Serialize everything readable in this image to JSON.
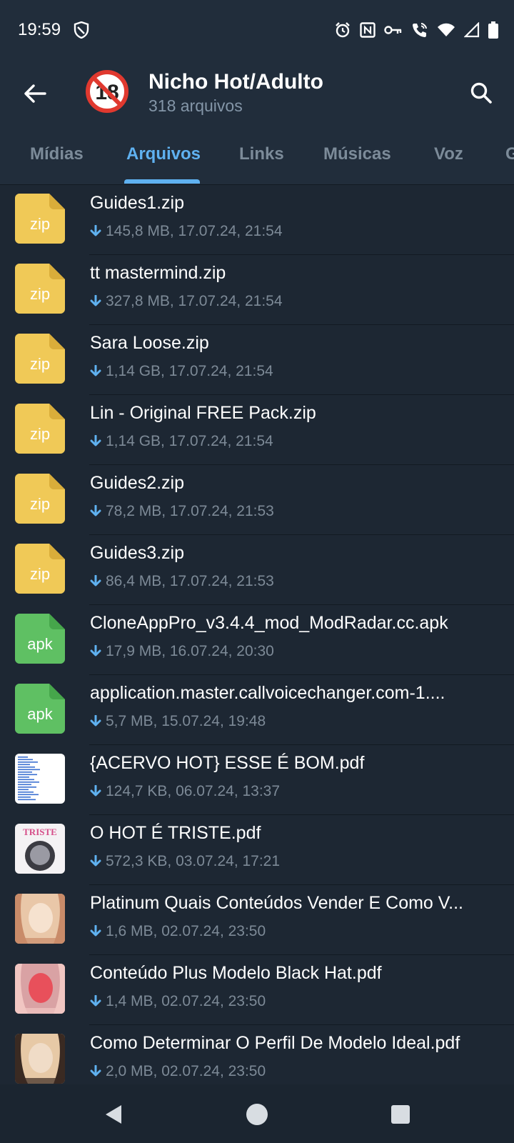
{
  "status_bar": {
    "time": "19:59",
    "icons": [
      "shield-icon",
      "alarm-icon",
      "nfc-icon",
      "key-icon",
      "wifi-call-icon",
      "wifi-icon",
      "signal-icon",
      "battery-icon"
    ]
  },
  "header": {
    "title": "Nicho Hot/Adulto",
    "subtitle": "318 arquivos",
    "avatar_text": "18",
    "back_icon": "arrow-left-icon",
    "search_icon": "search-icon"
  },
  "tabs": [
    {
      "label": "Mídias",
      "active": false
    },
    {
      "label": "Arquivos",
      "active": true
    },
    {
      "label": "Links",
      "active": false
    },
    {
      "label": "Músicas",
      "active": false
    },
    {
      "label": "Voz",
      "active": false
    },
    {
      "label": "G",
      "active": false
    }
  ],
  "files": [
    {
      "name": "Guides1.zip",
      "meta": "145,8 MB, 17.07.24, 21:54",
      "icon_type": "zip",
      "icon_text": "zip"
    },
    {
      "name": "tt mastermind.zip",
      "meta": "327,8 MB, 17.07.24, 21:54",
      "icon_type": "zip",
      "icon_text": "zip"
    },
    {
      "name": "Sara Loose.zip",
      "meta": "1,14 GB, 17.07.24, 21:54",
      "icon_type": "zip",
      "icon_text": "zip"
    },
    {
      "name": "Lin - Original FREE Pack.zip",
      "meta": "1,14 GB, 17.07.24, 21:54",
      "icon_type": "zip",
      "icon_text": "zip"
    },
    {
      "name": "Guides2.zip",
      "meta": "78,2 MB, 17.07.24, 21:53",
      "icon_type": "zip",
      "icon_text": "zip"
    },
    {
      "name": "Guides3.zip",
      "meta": "86,4 MB, 17.07.24, 21:53",
      "icon_type": "zip",
      "icon_text": "zip"
    },
    {
      "name": "CloneAppPro_v3.4.4_mod_ModRadar.cc.apk",
      "meta": "17,9 MB, 16.07.24, 20:30",
      "icon_type": "apk",
      "icon_text": "apk"
    },
    {
      "name": "application.master.callvoicechanger.com-1....",
      "meta": "5,7 MB, 15.07.24, 19:48",
      "icon_type": "apk",
      "icon_text": "apk"
    },
    {
      "name": "{ACERVO HOT} ESSE É BOM.pdf",
      "meta": "124,7 KB, 06.07.24, 13:37",
      "icon_type": "thumb-doc",
      "icon_text": ""
    },
    {
      "name": "O HOT É TRISTE.pdf",
      "meta": "572,3 KB, 03.07.24, 17:21",
      "icon_type": "thumb-triste",
      "icon_text": "TRISTE"
    },
    {
      "name": "Platinum Quais Conteúdos Vender E Como V...",
      "meta": "1,6 MB, 02.07.24, 23:50",
      "icon_type": "thumb-photo1",
      "icon_text": ""
    },
    {
      "name": "Conteúdo Plus Modelo Black Hat.pdf",
      "meta": "1,4 MB, 02.07.24, 23:50",
      "icon_type": "thumb-photo2",
      "icon_text": ""
    },
    {
      "name": "Como Determinar O Perfil De Modelo Ideal.pdf",
      "meta": "2,0 MB, 02.07.24, 23:50",
      "icon_type": "thumb-photo3",
      "icon_text": ""
    }
  ],
  "colors": {
    "background": "#1d2733",
    "header": "#212d3b",
    "accent": "#5fb1f0",
    "zip": "#f0c957",
    "apk": "#5fc063",
    "muted_text": "#7d8a97"
  },
  "nav_bar": {
    "back_icon": "nav-back-icon",
    "home_icon": "nav-home-icon",
    "recents_icon": "nav-recents-icon"
  }
}
